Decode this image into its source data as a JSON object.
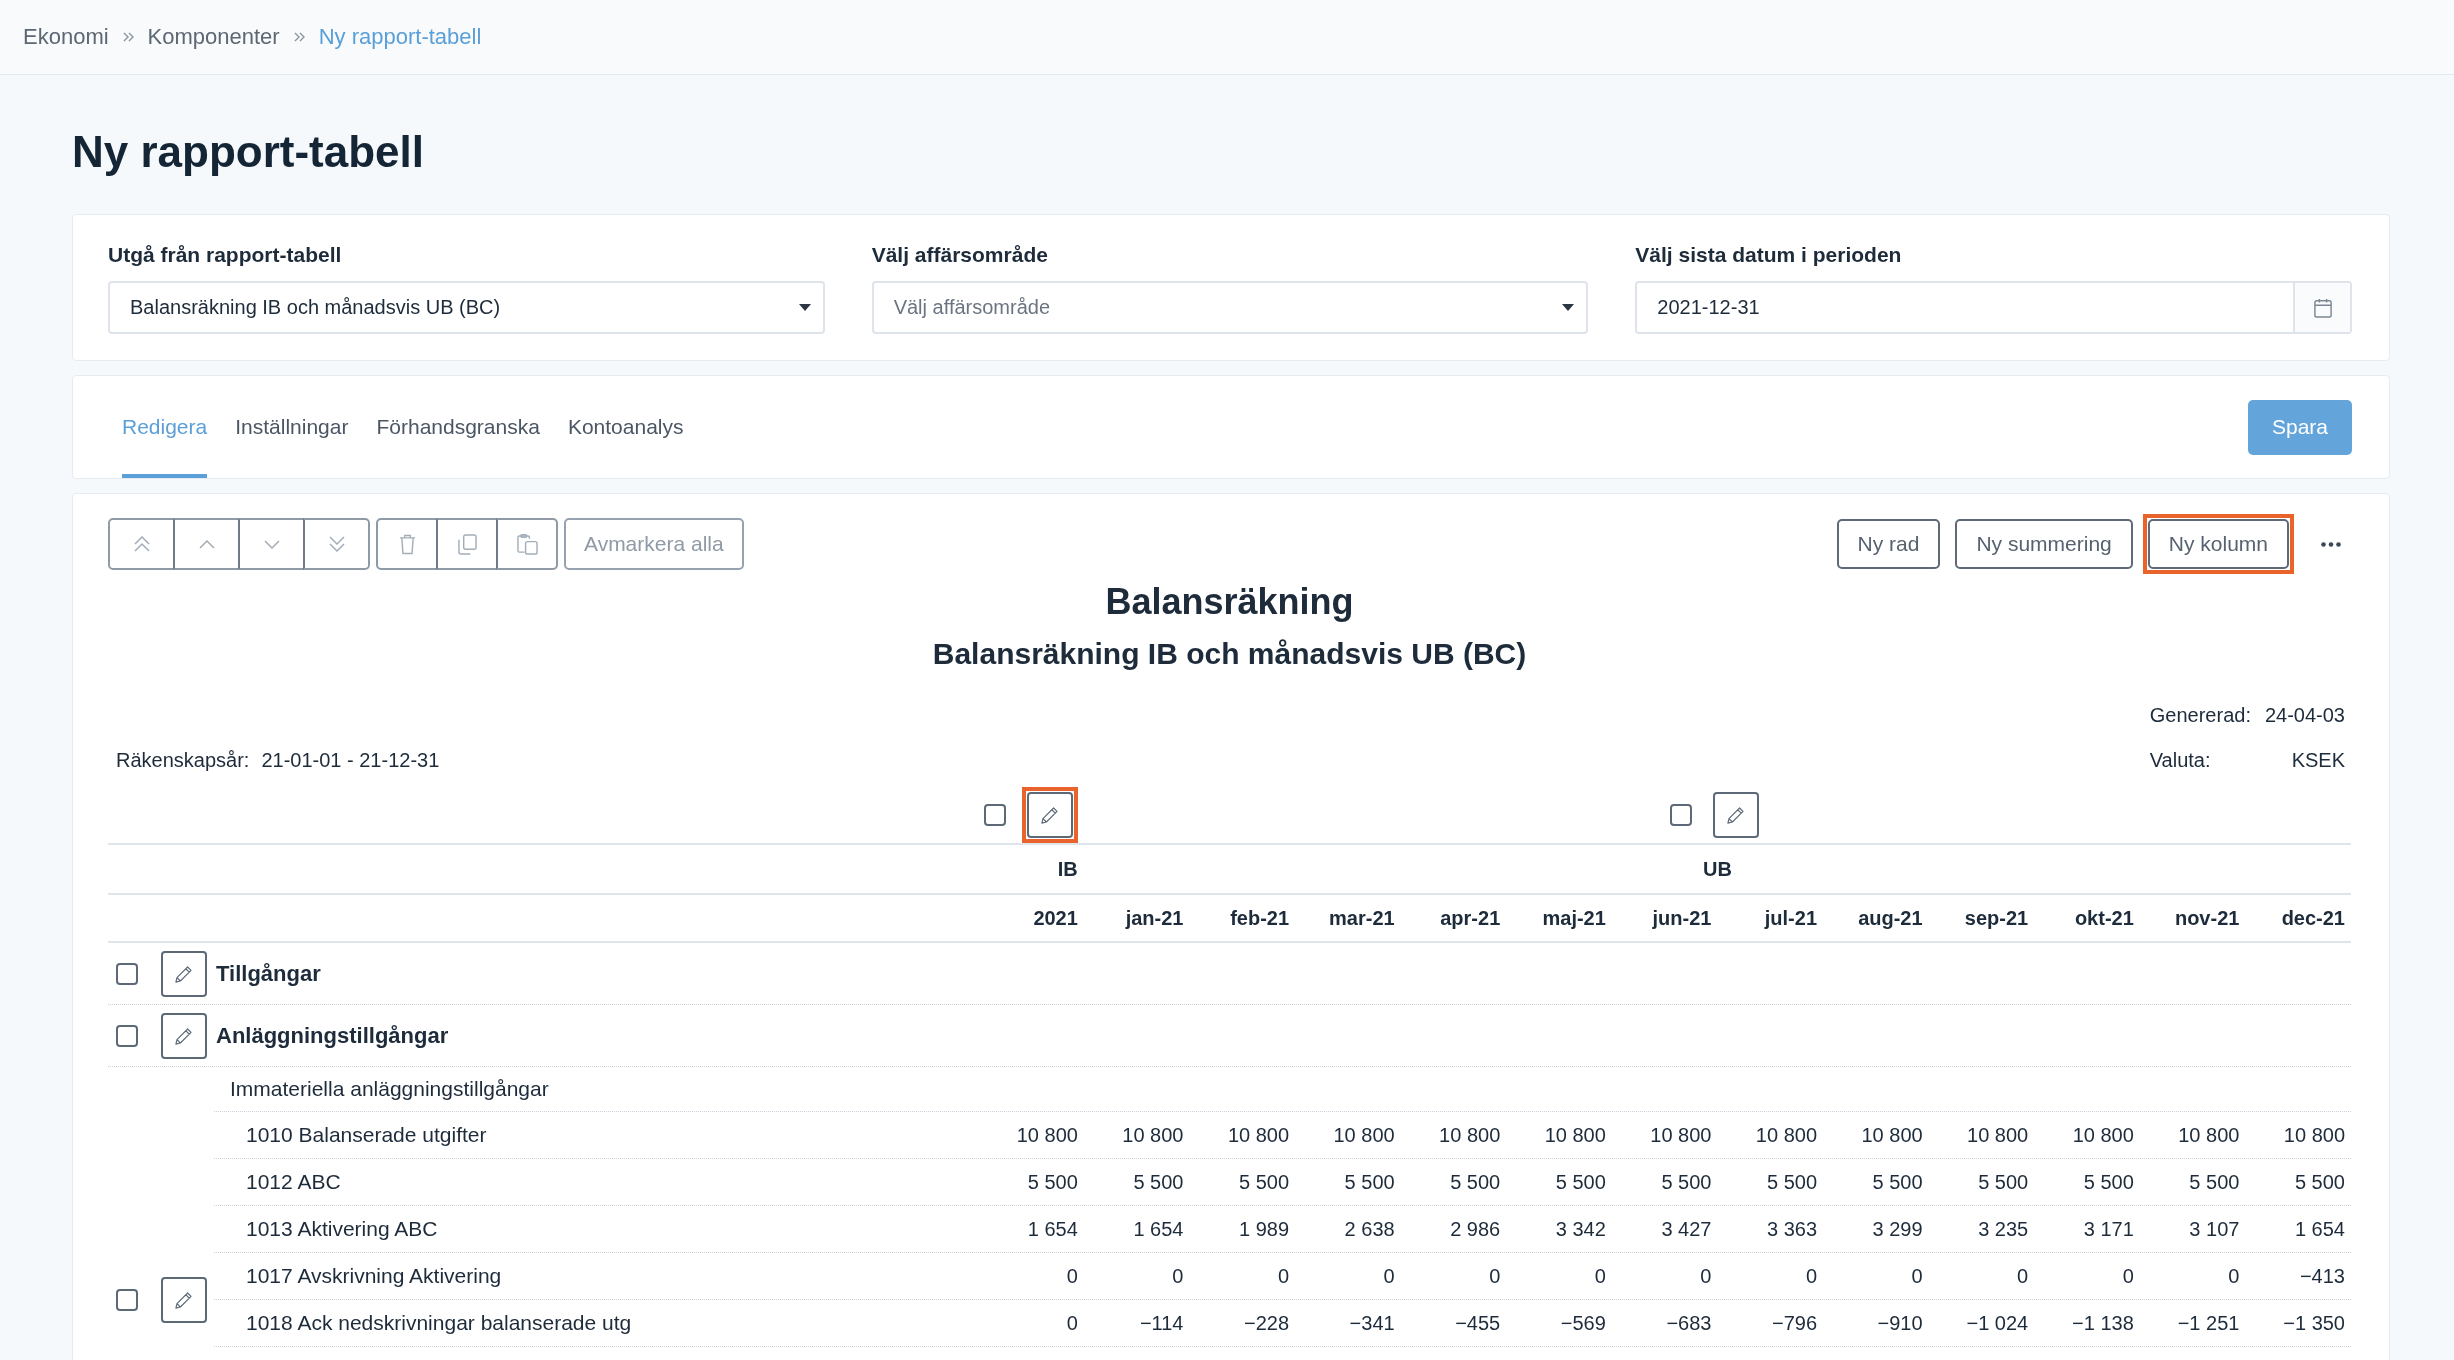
{
  "breadcrumb": [
    {
      "label": "Ekonomi",
      "current": false
    },
    {
      "label": "Komponenter",
      "current": false
    },
    {
      "label": "Ny rapport-tabell",
      "current": true
    }
  ],
  "page_title": "Ny rapport-tabell",
  "filters": [
    {
      "kind": "select",
      "label": "Utgå från rapport-tabell",
      "value": "Balansräkning IB och månadsvis UB (BC)"
    },
    {
      "kind": "select",
      "label": "Välj affärsområde",
      "placeholder": "Välj affärsområde"
    },
    {
      "kind": "date",
      "label": "Välj sista datum i perioden",
      "value": "2021-12-31"
    }
  ],
  "tabs": [
    {
      "label": "Redigera",
      "selected": true
    },
    {
      "label": "Inställningar",
      "selected": false
    },
    {
      "label": "Förhandsgranska",
      "selected": false
    },
    {
      "label": "Kontoanalys",
      "selected": false
    }
  ],
  "save_button": "Spara",
  "toolbar": {
    "move_buttons": [
      {
        "kind": "move-top",
        "disabled": true
      },
      {
        "kind": "move-up",
        "disabled": true
      },
      {
        "kind": "move-down",
        "disabled": true
      },
      {
        "kind": "move-bottom",
        "disabled": true
      }
    ],
    "edit_buttons": [
      {
        "kind": "delete",
        "disabled": true
      },
      {
        "kind": "copy",
        "disabled": true
      },
      {
        "kind": "paste",
        "disabled": true
      }
    ],
    "deselect_button": {
      "label": "Avmarkera alla",
      "disabled": true
    },
    "add_buttons": [
      {
        "label": "Ny rad",
        "highlighted": false
      },
      {
        "label": "Ny summering",
        "highlighted": false
      },
      {
        "label": "Ny kolumn",
        "highlighted": true
      }
    ]
  },
  "report": {
    "title": "Balansräkning",
    "subtitle": "Balansräkning IB och månadsvis UB (BC)",
    "meta_left": [
      {
        "label": "Räkenskapsår:",
        "value": "21-01-01 - 21-12-31"
      }
    ],
    "meta_right": [
      {
        "label": "Genererad:",
        "value": "24-04-03"
      },
      {
        "label": "Valuta:",
        "value": "KSEK"
      }
    ],
    "column_groups": [
      {
        "label": "IB",
        "checked": false,
        "highlighted": true,
        "columns": [
          "2021"
        ]
      },
      {
        "label": "UB",
        "checked": false,
        "highlighted": false,
        "columns": [
          "jan-21",
          "feb-21",
          "mar-21",
          "apr-21",
          "maj-21",
          "jun-21",
          "jul-21",
          "aug-21",
          "sep-21",
          "okt-21",
          "nov-21",
          "dec-21"
        ]
      }
    ],
    "row_groups": [
      {
        "checked": false,
        "rows": [
          {
            "kind": "heading",
            "label": "Tillgångar"
          }
        ]
      },
      {
        "checked": false,
        "rows": [
          {
            "kind": "heading",
            "label": "Anläggningstillgångar"
          }
        ]
      },
      {
        "rows": [
          {
            "kind": "subheading",
            "label": "Immateriella anläggningstillgångar"
          },
          {
            "kind": "account",
            "label": "1010 Balanserade utgifter",
            "values": [
              "10 800",
              "10 800",
              "10 800",
              "10 800",
              "10 800",
              "10 800",
              "10 800",
              "10 800",
              "10 800",
              "10 800",
              "10 800",
              "10 800",
              "10 800"
            ]
          },
          {
            "kind": "account",
            "label": "1012 ABC",
            "values": [
              "5 500",
              "5 500",
              "5 500",
              "5 500",
              "5 500",
              "5 500",
              "5 500",
              "5 500",
              "5 500",
              "5 500",
              "5 500",
              "5 500",
              "5 500"
            ]
          },
          {
            "kind": "account",
            "label": "1013 Aktivering ABC",
            "values": [
              "1 654",
              "1 654",
              "1 989",
              "2 638",
              "2 986",
              "3 342",
              "3 427",
              "3 363",
              "3 299",
              "3 235",
              "3 171",
              "3 107",
              "1 654"
            ]
          }
        ]
      },
      {
        "checked": false,
        "rows": [
          {
            "kind": "account",
            "label": "1017 Avskrivning Aktivering",
            "values": [
              "0",
              "0",
              "0",
              "0",
              "0",
              "0",
              "0",
              "0",
              "0",
              "0",
              "0",
              "0",
              "−413"
            ]
          },
          {
            "kind": "account",
            "label": "1018 Ack nedskrivningar balanserade utg",
            "values": [
              "0",
              "−114",
              "−228",
              "−341",
              "−455",
              "−569",
              "−683",
              "−796",
              "−910",
              "−1 024",
              "−1 138",
              "−1 251",
              "−1 350"
            ]
          }
        ]
      }
    ]
  }
}
